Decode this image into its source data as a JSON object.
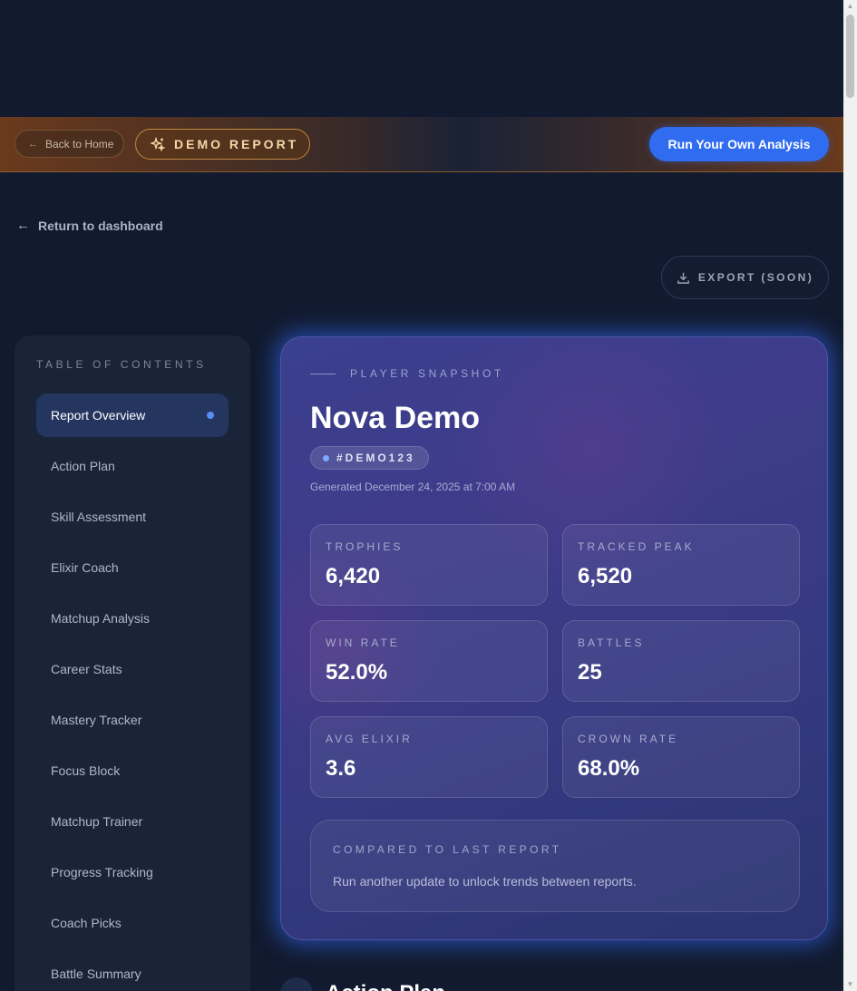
{
  "banner": {
    "back_label": "Back to Home",
    "demo_label": "DEMO REPORT",
    "run_label": "Run Your Own Analysis"
  },
  "nav": {
    "return_label": "Return to dashboard",
    "export_label": "EXPORT (SOON)"
  },
  "toc": {
    "title": "TABLE OF CONTENTS",
    "items": [
      {
        "label": "Report Overview",
        "active": true
      },
      {
        "label": "Action Plan"
      },
      {
        "label": "Skill Assessment"
      },
      {
        "label": "Elixir Coach"
      },
      {
        "label": "Matchup Analysis"
      },
      {
        "label": "Career Stats"
      },
      {
        "label": "Mastery Tracker"
      },
      {
        "label": "Focus Block"
      },
      {
        "label": "Matchup Trainer"
      },
      {
        "label": "Progress Tracking"
      },
      {
        "label": "Coach Picks"
      },
      {
        "label": "Battle Summary"
      }
    ]
  },
  "snapshot": {
    "eyebrow": "PLAYER SNAPSHOT",
    "name": "Nova Demo",
    "tag": "#DEMO123",
    "generated": "Generated December 24, 2025 at 7:00 AM",
    "stats": [
      {
        "label": "TROPHIES",
        "value": "6,420"
      },
      {
        "label": "TRACKED PEAK",
        "value": "6,520"
      },
      {
        "label": "WIN RATE",
        "value": "52.0%"
      },
      {
        "label": "BATTLES",
        "value": "25"
      },
      {
        "label": "AVG ELIXIR",
        "value": "3.6"
      },
      {
        "label": "CROWN RATE",
        "value": "68.0%"
      }
    ],
    "compare_title": "COMPARED TO LAST REPORT",
    "compare_text": "Run another update to unlock trends between reports."
  },
  "next_section": {
    "title": "Action Plan"
  },
  "colors": {
    "accent": "#2f6cf0",
    "demo_gold": "#c08a3e",
    "active_nav": "#243660"
  }
}
